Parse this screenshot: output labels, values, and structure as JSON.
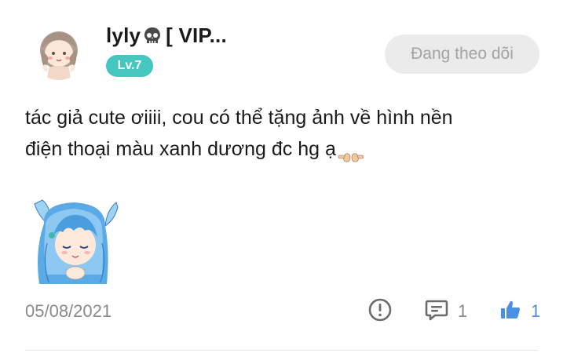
{
  "post": {
    "username": "lyly",
    "username_suffix": " [ VIP...",
    "level": "Lv.7",
    "follow_label": "Đang theo dõi",
    "content_line1": "tác giả cute ơiiii,  cou có thể tặng ảnh về hình nền",
    "content_line2": "điện thoại màu xanh dương đc hg ạ",
    "date": "05/08/2021",
    "comment_count": "1",
    "like_count": "1"
  },
  "icons": {
    "username_emoji": "skull-icon",
    "content_emoji": "pointing-hands-icon",
    "report": "exclamation-circle-icon",
    "comment": "comment-bubble-icon",
    "like": "thumbs-up-icon"
  },
  "colors": {
    "level_badge": "#45c7c0",
    "follow_bg": "#ebebeb",
    "follow_text": "#a3a3a3",
    "meta_gray": "#8a8a8a",
    "like_blue": "#4a90e2"
  }
}
